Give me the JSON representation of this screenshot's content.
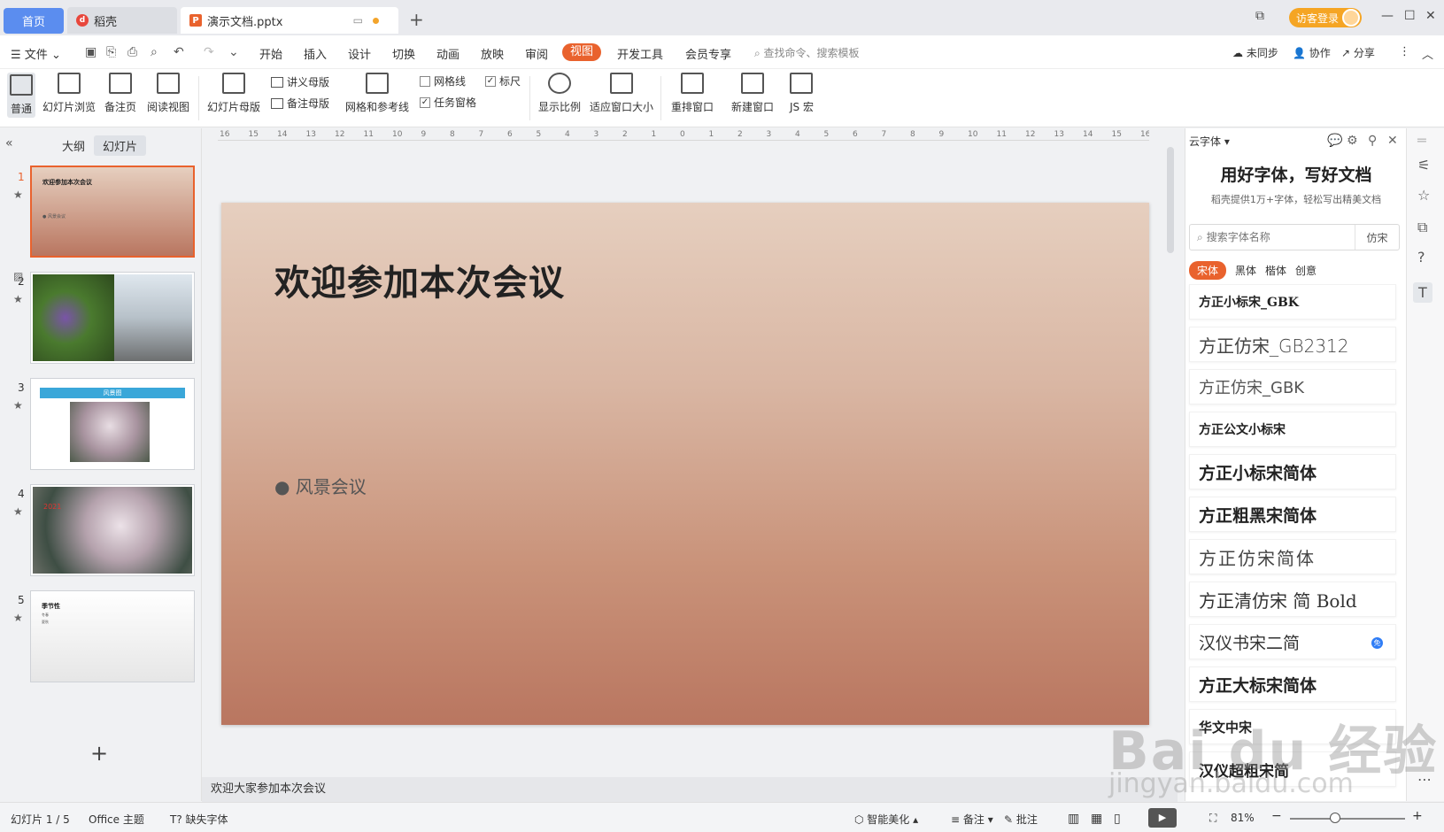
{
  "titlebar": {
    "home_tab": "首页",
    "daoke_tab": "稻壳",
    "doc_tab": "演示文档.pptx",
    "guest_login": "访客登录"
  },
  "menu": {
    "file": "文件",
    "items": [
      "开始",
      "插入",
      "设计",
      "切换",
      "动画",
      "放映",
      "审阅",
      "视图",
      "开发工具",
      "会员专享"
    ],
    "active": "视图",
    "search": "查找命令、搜索模板",
    "sync": "未同步",
    "collab": "协作",
    "share": "分享"
  },
  "ribbon": {
    "normal": "普通",
    "slide_browse": "幻灯片浏览",
    "notes_page": "备注页",
    "reading_view": "阅读视图",
    "slide_master": "幻灯片母版",
    "handout_master": "讲义母版",
    "notes_master": "备注母版",
    "grid_guides": "网格和参考线",
    "gridlines": "网格线",
    "ruler": "标尺",
    "task_pane": "任务窗格",
    "zoom": "显示比例",
    "fit_window": "适应窗口大小",
    "arrange": "重排窗口",
    "new_window": "新建窗口",
    "js_macro": "JS 宏"
  },
  "left_panel": {
    "outline_tab": "大纲",
    "slides_tab": "幻灯片",
    "slides": [
      {
        "num": "1",
        "title": "欢迎参加本次会议",
        "bullet": "● 风景会议"
      },
      {
        "num": "2"
      },
      {
        "num": "3",
        "title": "风景图"
      },
      {
        "num": "4",
        "label": "2021"
      },
      {
        "num": "5",
        "title": "季节性",
        "line1": "冬春",
        "line2": "夏秋"
      }
    ]
  },
  "ruler": [
    "16",
    "15",
    "14",
    "13",
    "12",
    "11",
    "10",
    "9",
    "8",
    "7",
    "6",
    "5",
    "4",
    "3",
    "2",
    "1",
    "0",
    "1",
    "2",
    "3",
    "4",
    "5",
    "6",
    "7",
    "8",
    "9",
    "10",
    "11",
    "12",
    "13",
    "14",
    "15",
    "16"
  ],
  "slide": {
    "title": "欢迎参加本次会议",
    "bullet": "● 风景会议"
  },
  "notes": "欢迎大家参加本次会议",
  "font_panel": {
    "header": "云字体",
    "headline": "用好字体，写好文档",
    "subline": "稻壳提供1万+字体，轻松写出精美文档",
    "search_placeholder": "搜索字体名称",
    "search_tag": "仿宋",
    "categories": [
      "宋体",
      "黑体",
      "楷体",
      "创意"
    ],
    "active_category": "宋体",
    "fonts": [
      "方正小标宋_GBK",
      "方正仿宋_GB2312",
      "方正仿宋_GBK",
      "方正公文小标宋",
      "方正小标宋简体",
      "方正粗黑宋简体",
      "方正仿宋简体",
      "方正清仿宋 简 Bold",
      "汉仪书宋二简",
      "方正大标宋简体",
      "华文中宋",
      "汉仪超粗宋简"
    ],
    "vip_badge": "免"
  },
  "statusbar": {
    "slide_pos": "幻灯片 1 / 5",
    "theme": "Office 主题",
    "missing_font": "缺失字体",
    "smart_beautify": "智能美化",
    "notes": "备注",
    "comments": "批注",
    "zoom": "81%"
  },
  "watermark": {
    "main": "Bai du 经验",
    "sub": "jingyan.baidu.com"
  },
  "colors": {
    "accent": "#e9622d",
    "home_tab": "#5b8def",
    "guest": "#f5a524"
  }
}
